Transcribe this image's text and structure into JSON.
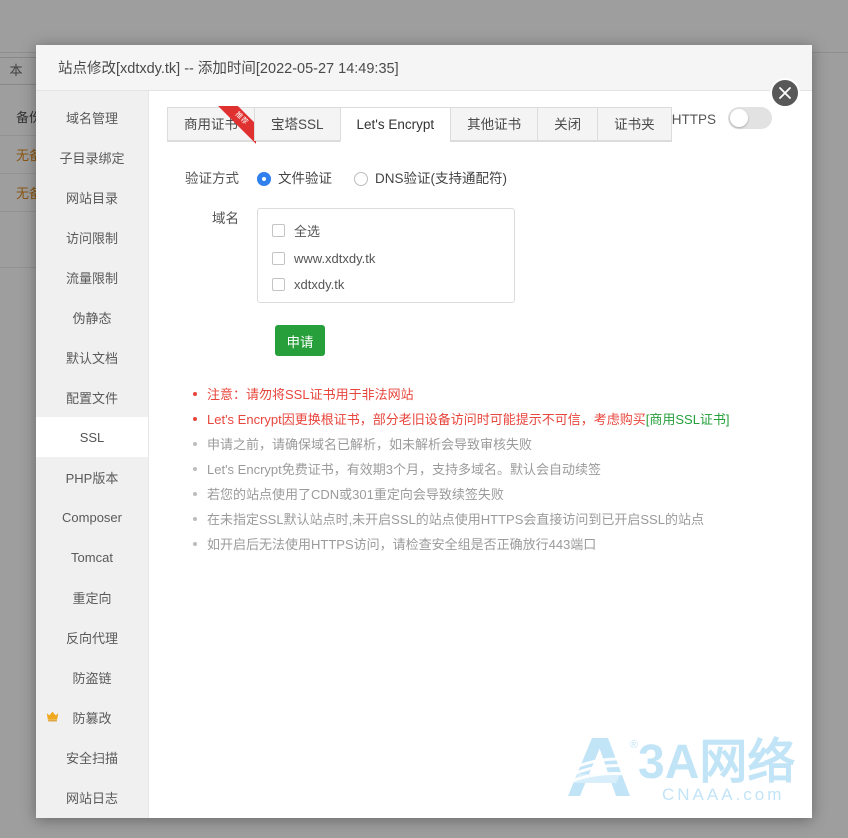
{
  "background": {
    "buttons": [
      "本",
      "备"
    ],
    "table": {
      "headers": [
        "备份"
      ],
      "rows": [
        {
          "cell": "无备份"
        },
        {
          "cell": "无备份"
        }
      ]
    }
  },
  "modal": {
    "title": "站点修改[xdtxdy.tk] -- 添加时间[2022-05-27 14:49:35]",
    "close_icon": "close-icon",
    "sidebar": {
      "items": [
        {
          "label": "域名管理",
          "active": false,
          "icon": null
        },
        {
          "label": "子目录绑定",
          "active": false,
          "icon": null
        },
        {
          "label": "网站目录",
          "active": false,
          "icon": null
        },
        {
          "label": "访问限制",
          "active": false,
          "icon": null
        },
        {
          "label": "流量限制",
          "active": false,
          "icon": null
        },
        {
          "label": "伪静态",
          "active": false,
          "icon": null
        },
        {
          "label": "默认文档",
          "active": false,
          "icon": null
        },
        {
          "label": "配置文件",
          "active": false,
          "icon": null
        },
        {
          "label": "SSL",
          "active": true,
          "icon": null
        },
        {
          "label": "PHP版本",
          "active": false,
          "icon": null
        },
        {
          "label": "Composer",
          "active": false,
          "icon": null
        },
        {
          "label": "Tomcat",
          "active": false,
          "icon": null
        },
        {
          "label": "重定向",
          "active": false,
          "icon": null
        },
        {
          "label": "反向代理",
          "active": false,
          "icon": null
        },
        {
          "label": "防盗链",
          "active": false,
          "icon": null
        },
        {
          "label": "防篡改",
          "active": false,
          "icon": "crown-icon"
        },
        {
          "label": "安全扫描",
          "active": false,
          "icon": null
        },
        {
          "label": "网站日志",
          "active": false,
          "icon": null
        }
      ]
    },
    "tabs": [
      {
        "label": "商用证书",
        "active": false,
        "ribbon": "推荐"
      },
      {
        "label": "宝塔SSL",
        "active": false,
        "ribbon": null
      },
      {
        "label": "Let's Encrypt",
        "active": true,
        "ribbon": null
      },
      {
        "label": "其他证书",
        "active": false,
        "ribbon": null
      },
      {
        "label": "关闭",
        "active": false,
        "ribbon": null
      },
      {
        "label": "证书夹",
        "active": false,
        "ribbon": null
      }
    ],
    "force_https": {
      "label": "强制HTTPS",
      "enabled": false
    },
    "form": {
      "verify_label": "验证方式",
      "verify_options": [
        {
          "label": "文件验证",
          "selected": true
        },
        {
          "label": "DNS验证(支持通配符)",
          "selected": false
        }
      ],
      "domain_label": "域名",
      "domains": [
        {
          "label": "全选",
          "checked": false
        },
        {
          "label": "www.xdtxdy.tk",
          "checked": false
        },
        {
          "label": "xdtxdy.tk",
          "checked": false
        }
      ],
      "apply_label": "申请"
    },
    "notes": [
      {
        "text": "注意：请勿将SSL证书用于非法网站",
        "style": "warn",
        "green_suffix": null
      },
      {
        "text": "Let's Encrypt因更换根证书，部分老旧设备访问时可能提示不可信，考虑购买",
        "style": "warn",
        "green_suffix": "[商用SSL证书]"
      },
      {
        "text": "申请之前，请确保域名已解析，如未解析会导致审核失败",
        "style": "normal",
        "green_suffix": null
      },
      {
        "text": "Let's Encrypt免费证书，有效期3个月，支持多域名。默认会自动续签",
        "style": "normal",
        "green_suffix": null
      },
      {
        "text": "若您的站点使用了CDN或301重定向会导致续签失败",
        "style": "normal",
        "green_suffix": null
      },
      {
        "text": "在未指定SSL默认站点时,未开启SSL的站点使用HTTPS会直接访问到已开启SSL的站点",
        "style": "normal",
        "green_suffix": null
      },
      {
        "text": "如开启后无法使用HTTPS访问，请检查安全组是否正确放行443端口",
        "style": "normal",
        "green_suffix": null
      }
    ]
  },
  "watermark": {
    "brand": "3A网络",
    "domain": "CNAAA.com",
    "mark": "A",
    "registered": "®",
    "color": "#a9d9f3"
  },
  "colors": {
    "accent_green": "#27a03c",
    "warn_red": "#e8453c",
    "radio_blue": "#2f80ed",
    "ribbon_red": "#e03131",
    "crown_gold": "#f0a81e"
  }
}
